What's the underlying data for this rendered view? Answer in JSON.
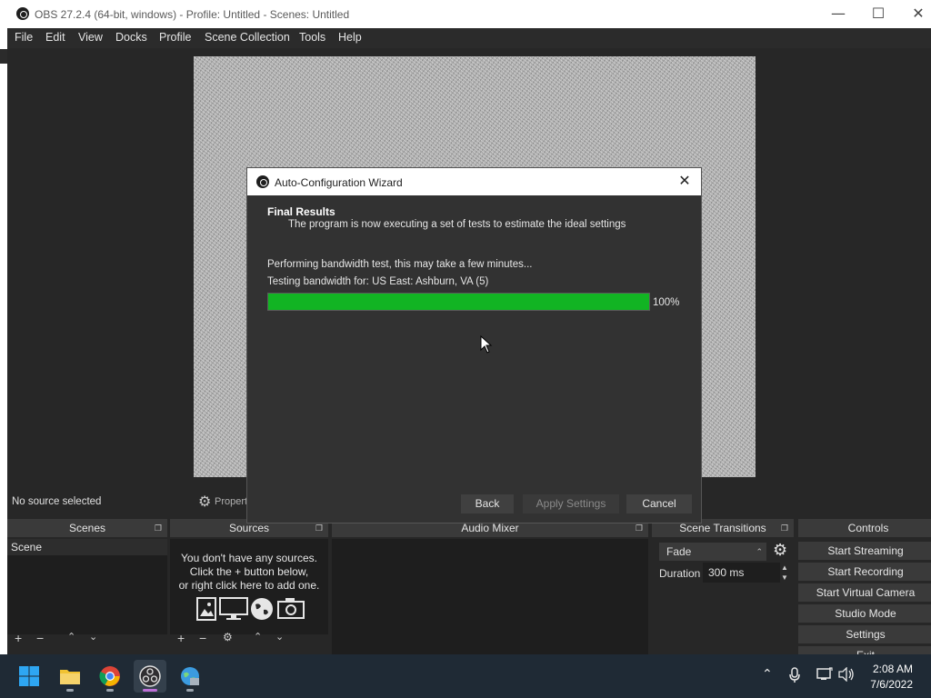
{
  "window": {
    "title": "OBS 27.2.4 (64-bit, windows) - Profile: Untitled - Scenes: Untitled",
    "minimize": "—",
    "maximize": "☐",
    "close": "✕"
  },
  "menu": [
    "File",
    "Edit",
    "View",
    "Docks",
    "Profile",
    "Scene Collection",
    "Tools",
    "Help"
  ],
  "status": {
    "no_source": "No source selected",
    "properties_label": "Properties"
  },
  "docks": {
    "scenes": {
      "title": "Scenes",
      "items": [
        "Scene"
      ]
    },
    "sources": {
      "title": "Sources",
      "empty_line1": "You don't have any sources.",
      "empty_line2": "Click the + button below,",
      "empty_line3": "or right click here to add one."
    },
    "audio_mixer": {
      "title": "Audio Mixer"
    },
    "scene_transitions": {
      "title": "Scene Transitions",
      "transition": "Fade",
      "duration_label": "Duration",
      "duration_value": "300 ms"
    },
    "controls": {
      "title": "Controls",
      "buttons": [
        "Start Streaming",
        "Start Recording",
        "Start Virtual Camera",
        "Studio Mode",
        "Settings",
        "Exit"
      ]
    }
  },
  "wizard": {
    "title": "Auto-Configuration Wizard",
    "close": "✕",
    "heading": "Final Results",
    "subheading": "The program is now executing a set of tests to estimate the ideal settings",
    "line1": "Performing bandwidth test, this may take a few minutes...",
    "line2": "Testing bandwidth for: US East: Ashburn, VA (5)",
    "progress_percent": 100,
    "progress_label": "100%",
    "buttons": {
      "back": "Back",
      "apply": "Apply Settings",
      "cancel": "Cancel"
    },
    "progress_color": "#12b423"
  },
  "taskbar": {
    "apps": [
      "windows-start",
      "file-explorer",
      "chrome",
      "obs-studio",
      "network-app"
    ],
    "time": "2:08 AM",
    "date": "7/6/2022"
  }
}
